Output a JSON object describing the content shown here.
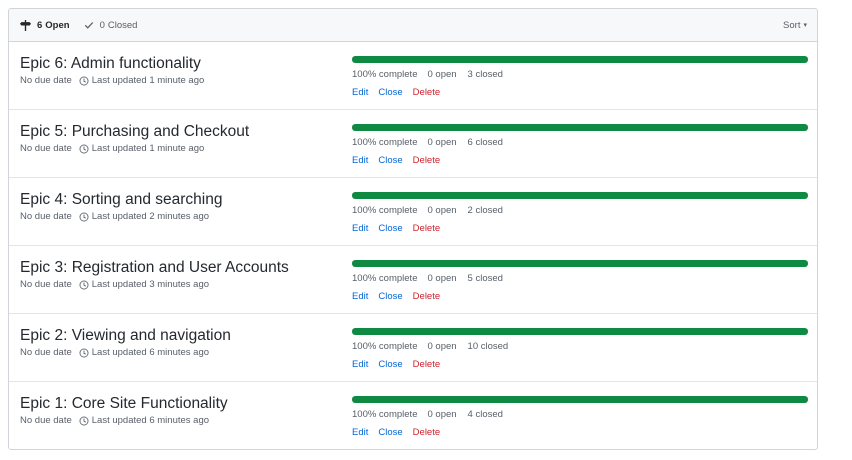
{
  "header": {
    "open_count": "6",
    "open_label": "Open",
    "closed_count": "0",
    "closed_label": "Closed",
    "sort_label": "Sort"
  },
  "colors": {
    "progress_fill": "#0f8a43",
    "link": "#0366d6",
    "danger": "#cb2431"
  },
  "milestones": [
    {
      "title": "Epic 6: Admin functionality",
      "due": "No due date",
      "updated": "Last updated 1 minute ago",
      "progress": 1.0,
      "percent_label": "100% complete",
      "open_label": "0 open",
      "closed_label": "3 closed",
      "edit": "Edit",
      "close": "Close",
      "delete": "Delete"
    },
    {
      "title": "Epic 5: Purchasing and Checkout",
      "due": "No due date",
      "updated": "Last updated 1 minute ago",
      "progress": 1.0,
      "percent_label": "100% complete",
      "open_label": "0 open",
      "closed_label": "6 closed",
      "edit": "Edit",
      "close": "Close",
      "delete": "Delete"
    },
    {
      "title": "Epic 4: Sorting and searching",
      "due": "No due date",
      "updated": "Last updated 2 minutes ago",
      "progress": 1.0,
      "percent_label": "100% complete",
      "open_label": "0 open",
      "closed_label": "2 closed",
      "edit": "Edit",
      "close": "Close",
      "delete": "Delete"
    },
    {
      "title": "Epic 3: Registration and User Accounts",
      "due": "No due date",
      "updated": "Last updated 3 minutes ago",
      "progress": 1.0,
      "percent_label": "100% complete",
      "open_label": "0 open",
      "closed_label": "5 closed",
      "edit": "Edit",
      "close": "Close",
      "delete": "Delete"
    },
    {
      "title": "Epic 2: Viewing and navigation",
      "due": "No due date",
      "updated": "Last updated 6 minutes ago",
      "progress": 1.0,
      "percent_label": "100% complete",
      "open_label": "0 open",
      "closed_label": "10 closed",
      "edit": "Edit",
      "close": "Close",
      "delete": "Delete"
    },
    {
      "title": "Epic 1: Core Site Functionality",
      "due": "No due date",
      "updated": "Last updated 6 minutes ago",
      "progress": 1.0,
      "percent_label": "100% complete",
      "open_label": "0 open",
      "closed_label": "4 closed",
      "edit": "Edit",
      "close": "Close",
      "delete": "Delete"
    }
  ]
}
